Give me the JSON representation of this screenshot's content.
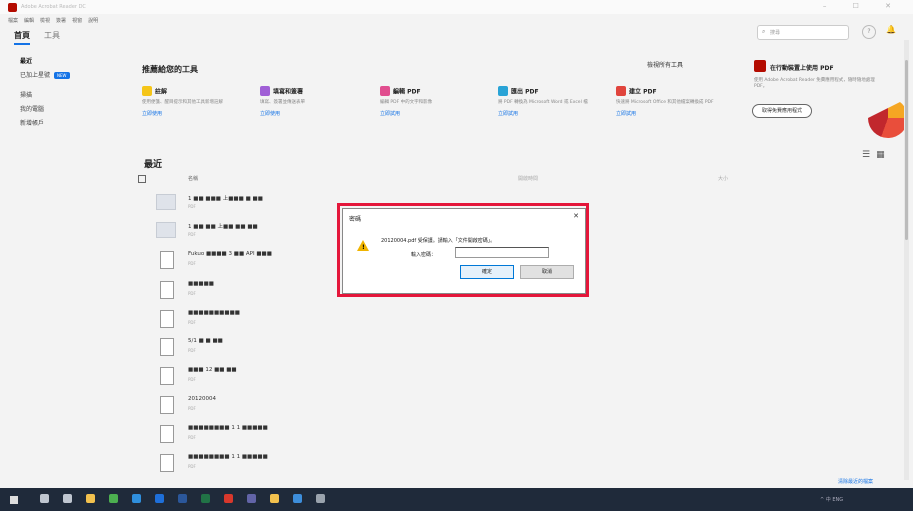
{
  "window": {
    "title": "Adobe Acrobat Reader DC",
    "controls": "– ☐ ✕"
  },
  "menu": [
    "檔案",
    "編輯",
    "檢視",
    "簽署",
    "視窗",
    "說明"
  ],
  "tabs": {
    "home": "首頁",
    "tools": "工具"
  },
  "search": {
    "placeholder": "搜尋"
  },
  "sidebar": {
    "items": [
      {
        "label": "最近"
      },
      {
        "label": "已加上星號",
        "badge": "NEW"
      },
      {
        "label": "掃描"
      },
      {
        "label": "我的電腦"
      },
      {
        "label": "新增帳戶"
      }
    ]
  },
  "tools": {
    "heading": "推薦給您的工具",
    "see_all": "檢視所有工具",
    "cards": [
      {
        "name": "註解",
        "desc": "使用便箋、醒目提示和其他工具新增註解",
        "link": "立即使用",
        "color": "#f5c518",
        "icon": "comment-icon"
      },
      {
        "name": "填寫和簽署",
        "desc": "填寫、簽署並傳送表單",
        "link": "立即使用",
        "color": "#a05fd6",
        "icon": "fill-sign-icon"
      },
      {
        "name": "編輯 PDF",
        "desc": "編輯 PDF 中的文字和影像",
        "link": "立即試用",
        "color": "#e14e8f",
        "icon": "edit-pdf-icon"
      },
      {
        "name": "匯出 PDF",
        "desc": "將 PDF 轉換為 Microsoft Word 或 Excel 檔",
        "link": "立即試用",
        "color": "#29a3d6",
        "icon": "export-pdf-icon"
      },
      {
        "name": "建立 PDF",
        "desc": "快速將 Microsoft Office 和其他檔案轉換成 PDF",
        "link": "立即試用",
        "color": "#e0443c",
        "icon": "create-pdf-icon"
      }
    ]
  },
  "promo": {
    "title": "在行動裝置上使用 PDF",
    "desc": "使用 Adobe Acrobat Reader 免費應用程式，隨時隨地處理 PDF。",
    "button": "取得免費應用程式"
  },
  "recent": {
    "heading": "最近",
    "columns": {
      "name": "名稱",
      "opened": "開啟時間",
      "size": "大小"
    },
    "files": [
      {
        "name": "1 ■■ ■■■ 上■■■ ■ ■■",
        "type": "PDF",
        "opened": "",
        "size": "",
        "thumb": "image"
      },
      {
        "name": "1 ■■ ■■ 上■■ ■■ ■■",
        "type": "PDF",
        "opened": "",
        "size": "",
        "thumb": "image"
      },
      {
        "name": "Fukuo ■■■■ 3 ■■ API ■■■",
        "type": "PDF",
        "opened": "",
        "size": "",
        "thumb": "pdf"
      },
      {
        "name": "■■■■■",
        "type": "PDF",
        "opened": "",
        "size": "",
        "thumb": "pdf"
      },
      {
        "name": "■■■■■■■■■■",
        "type": "PDF",
        "opened": "",
        "size": "",
        "thumb": "pdf"
      },
      {
        "name": "5/1 ■ ■ ■■",
        "type": "PDF",
        "opened": "",
        "size": "",
        "thumb": "pdf"
      },
      {
        "name": "■■■ 12 ■■ ■■",
        "type": "PDF",
        "opened": "",
        "size": "",
        "thumb": "pdf"
      },
      {
        "name": "20120004",
        "type": "PDF",
        "opened": "",
        "size": "",
        "thumb": "pdf"
      },
      {
        "name": "■■■■■■■■ 1 1 ■■■■■",
        "type": "PDF",
        "opened": "",
        "size": "",
        "thumb": "pdf"
      },
      {
        "name": "■■■■■■■■ 1 1 ■■■■■",
        "type": "PDF",
        "opened": "",
        "size": "",
        "thumb": "pdf"
      }
    ],
    "clear": "清除最近的檔案"
  },
  "dialog": {
    "title": "密碼",
    "message": "20120004.pdf 受保護。請輸入「文件開啟密碼」。",
    "password_label": "輸入密碼：",
    "ok": "確定",
    "cancel": "取消",
    "highlight_color": "#e4163a"
  },
  "taskbar": {
    "icons": [
      {
        "name": "search-taskbar-icon",
        "color": "#bfc6d0"
      },
      {
        "name": "task-view-icon",
        "color": "#bfc6d0"
      },
      {
        "name": "file-explorer-icon",
        "color": "#f2c14e"
      },
      {
        "name": "chrome-icon",
        "color": "#4caf50"
      },
      {
        "name": "edge-icon",
        "color": "#2f8fdd"
      },
      {
        "name": "outlook-icon",
        "color": "#1e6fd9"
      },
      {
        "name": "word-icon",
        "color": "#2b579a"
      },
      {
        "name": "excel-icon",
        "color": "#217346"
      },
      {
        "name": "acrobat-icon",
        "color": "#d8382c"
      },
      {
        "name": "teams-icon",
        "color": "#6264a7"
      },
      {
        "name": "folder-icon",
        "color": "#f2c14e"
      },
      {
        "name": "app-icon",
        "color": "#3d8edb"
      },
      {
        "name": "settings-icon",
        "color": "#9aa3ad"
      }
    ],
    "tray": "^ 中 ENG"
  }
}
